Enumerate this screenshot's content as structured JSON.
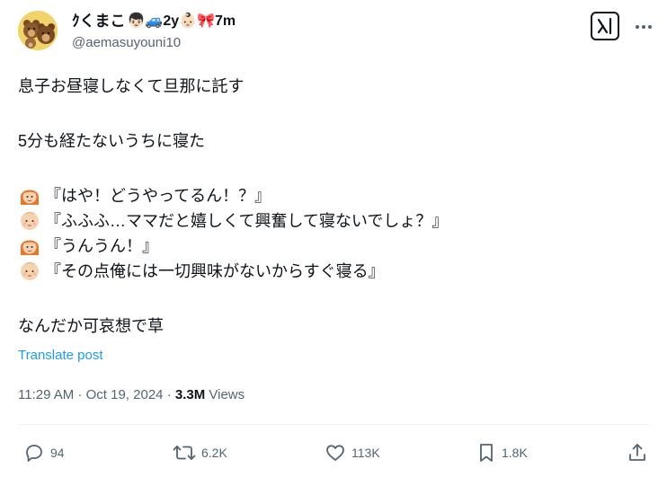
{
  "author": {
    "display_name": "ｸくまこ",
    "display_name_emoji": "👦🏻🚙2y👶🏻🎀7m",
    "handle": "@aemasuyouni10",
    "avatar_icon": "bear-family-avatar"
  },
  "tweet": {
    "line1": "息子お昼寝しなくて旦那に託す",
    "line2": "5分も経たないうちに寝た",
    "dialogue": [
      {
        "icon": "woman-face-icon",
        "text": "『はや！どうやってるん！？』"
      },
      {
        "icon": "baby-face-icon",
        "text": "『ふふふ…ママだと嬉しくて興奮して寝ないでしょ？』"
      },
      {
        "icon": "woman-face-icon",
        "text": "『うんうん！』"
      },
      {
        "icon": "baby-face-icon",
        "text": "『その点俺には一切興味がないからすぐ寝る』"
      }
    ],
    "closing": "なんだか可哀想で草",
    "translate_label": "Translate post"
  },
  "meta": {
    "time": "11:29 AM",
    "separator": "·",
    "date": "Oct 19, 2024",
    "views_count": "3.3M",
    "views_label": "Views"
  },
  "actions": {
    "replies": "94",
    "reposts": "6.2K",
    "likes": "113K",
    "bookmarks": "1.8K"
  },
  "colors": {
    "text": "#0f1419",
    "secondary": "#536471",
    "link": "#1d9bf0"
  }
}
